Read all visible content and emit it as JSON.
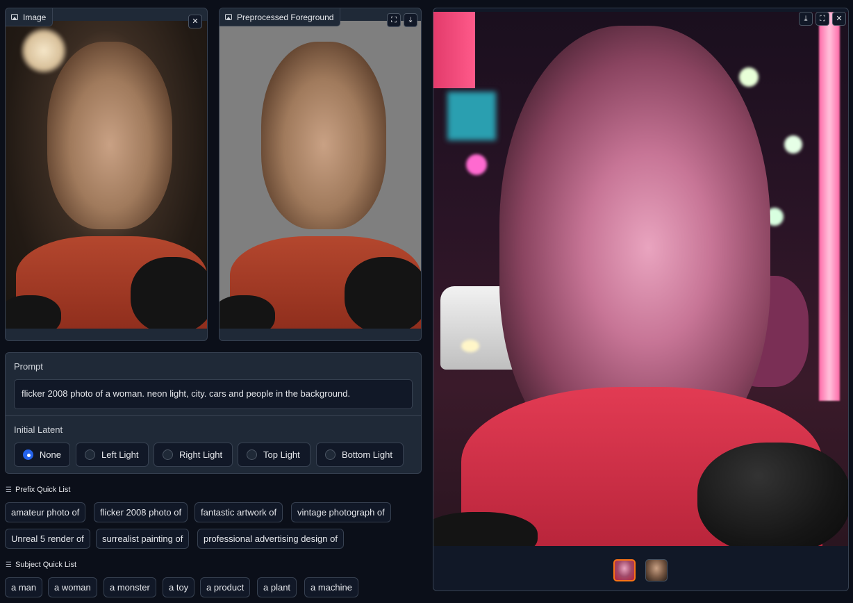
{
  "input_image": {
    "label": "Image",
    "close_icon": "close-icon"
  },
  "preprocessed": {
    "label": "Preprocessed Foreground",
    "fullscreen_icon": "fullscreen-icon",
    "download_icon": "download-icon"
  },
  "output": {
    "download_icon": "download-icon",
    "fullscreen_icon": "fullscreen-icon",
    "close_icon": "close-icon"
  },
  "prompt": {
    "label": "Prompt",
    "value": "flicker 2008 photo of a woman. neon light, city. cars and people in the background."
  },
  "initial_latent": {
    "label": "Initial Latent",
    "options": [
      "None",
      "Left Light",
      "Right Light",
      "Top Light",
      "Bottom Light"
    ],
    "selected": "None"
  },
  "prefix_quick_list": {
    "title": "Prefix Quick List",
    "items": [
      "amateur photo of",
      "flicker 2008 photo of",
      "fantastic artwork of",
      "vintage photograph of",
      "Unreal 5 render of",
      "surrealist painting of",
      "professional advertising design of"
    ]
  },
  "subject_quick_list": {
    "title": "Subject Quick List",
    "items": [
      "a man",
      "a woman",
      "a monster",
      "a toy",
      "a product",
      "a plant",
      "a machine"
    ]
  },
  "colors": {
    "accent": "#2563eb",
    "selected_thumb": "#f97316",
    "panel": "#1f2937",
    "background": "#0b0f19"
  }
}
